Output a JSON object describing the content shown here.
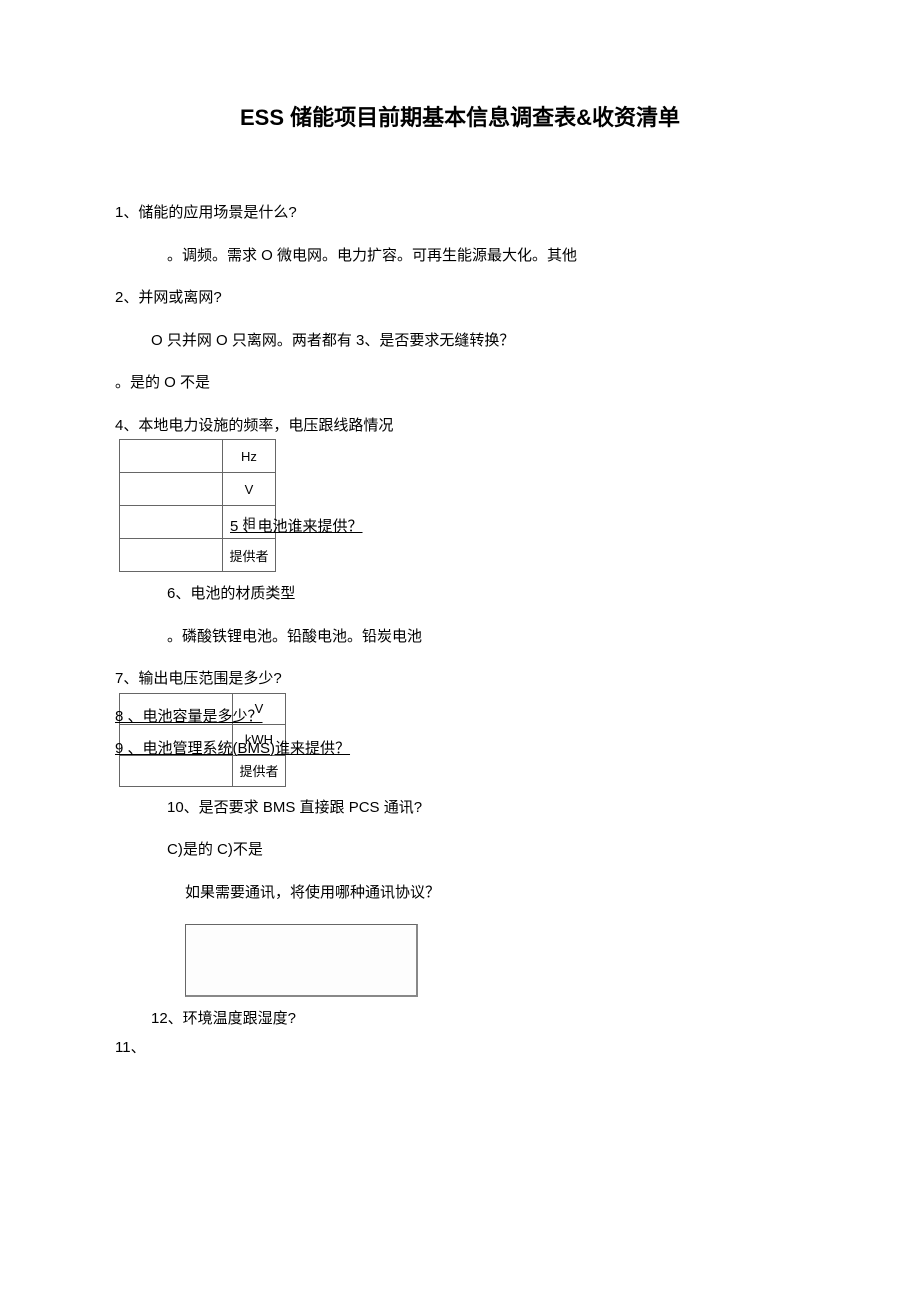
{
  "title": "ESS 储能项目前期基本信息调查表&收资清单",
  "q1": {
    "label": "1、储能的应用场景是什么?",
    "options": "。调频。需求 O 微电网。电力扩容。可再生能源最大化。其他"
  },
  "q2": {
    "label": "2、并网或离网?",
    "options": "O 只并网 O 只离网。两者都有 3、是否要求无缝转换？"
  },
  "q3_ans": "。是的 O 不是",
  "q4": {
    "label": "4、本地电力设施的频率，电压跟线路情况"
  },
  "table1": {
    "r1": "Hz",
    "r2": "V",
    "r3": "相",
    "r4": "提供者"
  },
  "q5": "5 、电池谁来提供？",
  "q6": {
    "label": "6、电池的材质类型",
    "options": "。磷酸铁锂电池。铅酸电池。铅炭电池"
  },
  "q7": "7、输出电压范围是多少?",
  "table2": {
    "r1": "V",
    "r2": "kWH",
    "r3": "提供者"
  },
  "q8": "8 、电池容量是多少？",
  "q9": "9 、电池管理系统(BMS)谁来提供？",
  "q10": {
    "label": "10、是否要求 BMS 直接跟 PCS 通讯?",
    "options": "C)是的 C)不是",
    "sub": "如果需要通讯，将使用哪种通讯协议？"
  },
  "q12": "12、环境温度跟湿度?",
  "q11": "11、"
}
